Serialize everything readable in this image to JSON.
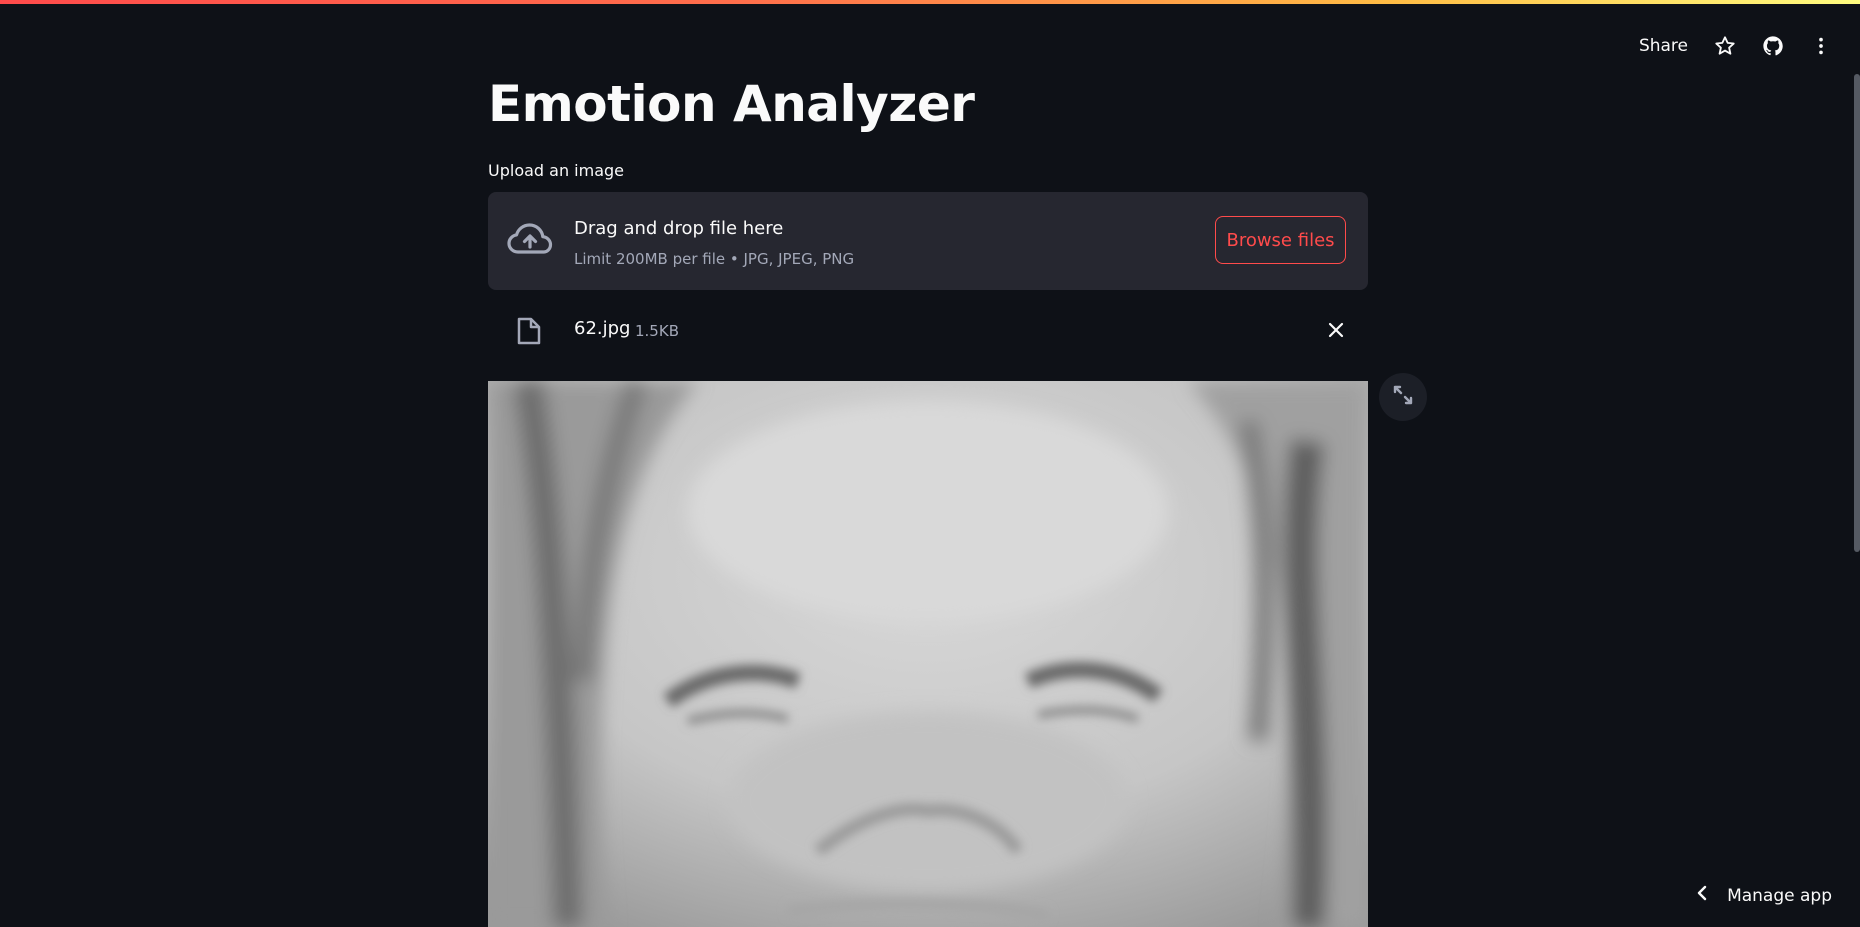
{
  "app": {
    "title": "Emotion Analyzer"
  },
  "toolbar": {
    "share_label": "Share",
    "icons": [
      "star-icon",
      "github-icon",
      "more-vertical-icon"
    ]
  },
  "uploader": {
    "label": "Upload an image",
    "drop_title": "Drag and drop file here",
    "limit_text": "Limit 200MB per file • JPG, JPEG, PNG",
    "browse_label": "Browse files"
  },
  "uploaded_file": {
    "name": "62.jpg",
    "size": "1.5KB"
  },
  "footer": {
    "manage_label": "Manage app"
  },
  "colors": {
    "background": "#0e1117",
    "panel": "#262730",
    "accent": "#ff4b4b",
    "text": "#fafafa",
    "muted": "#a3a8b8"
  }
}
